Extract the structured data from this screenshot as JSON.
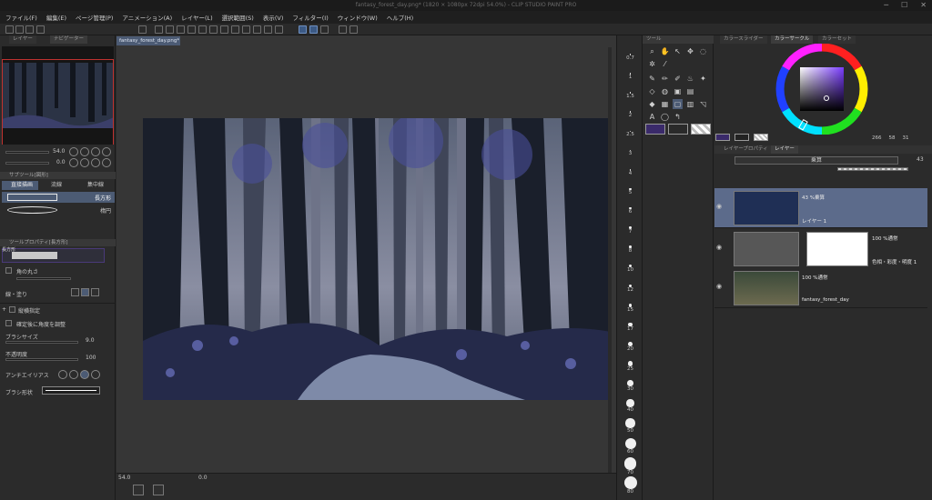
{
  "titlebar": {
    "text": "fantasy_forest_day.png* (1820 × 1080px 72dpi 54.0%) - CLIP STUDIO PAINT PRO"
  },
  "menu": [
    "ファイル(F)",
    "編集(E)",
    "ページ管理(P)",
    "アニメーション(A)",
    "レイヤー(L)",
    "選択範囲(S)",
    "表示(V)",
    "フィルター(I)",
    "ウィンドウ(W)",
    "ヘルプ(H)"
  ],
  "left": {
    "tab_layer_property": "レイヤー",
    "tab_navigator": "ナビゲーター",
    "zoom_value": "54.0",
    "rotate_value": "0.0",
    "subtool_header": "サブツール[図形]",
    "subtool_tabs": [
      "直接描画",
      "流線",
      "集中線"
    ],
    "shape_rect": "長方形",
    "shape_ellipse": "楕円",
    "tool_prop_header": "ツールプロパティ[長方形]",
    "corner_label": "角の丸さ",
    "line_fill_label": "線・塗り",
    "aspect_label": "縦横指定",
    "angle_label": "確定後に角度を調整",
    "brush_size_label": "ブラシサイズ",
    "brush_size_value": "9.0",
    "opacity_label": "不透明度",
    "opacity_value": "100",
    "antialias_label": "アンチエイリアス",
    "brush_shape_label": "ブラシ形状",
    "long_label": "長方形"
  },
  "canvas": {
    "doc_tab": "fantasy_forest_day.png*",
    "zoom_status": "54.0",
    "angle_status": "0.0"
  },
  "sizes": [
    "0.7",
    "1",
    "1.5",
    "2",
    "2.5",
    "3",
    "4",
    "5",
    "6",
    "7",
    "8",
    "10",
    "12",
    "15",
    "17",
    "20",
    "25",
    "30",
    "40",
    "50",
    "60",
    "70",
    "80"
  ],
  "right": {
    "tab_tool": "ツール",
    "tab_color_slider": "カラースライダー",
    "tab_color_circle": "カラーサークル",
    "tab_color_set": "カラーセット",
    "hsv_h": "266",
    "hsv_s": "58",
    "hsv_v": "31",
    "layer_tab_property": "レイヤープロパティ",
    "layer_tab_layer": "レイヤー",
    "blend_mode": "乗算",
    "opacity_value": "43",
    "layers": [
      {
        "line1": "43 %乗算",
        "line2": "レイヤー 1"
      },
      {
        "line1": "100 %通常",
        "line2": "色相・彩度・明度 1"
      },
      {
        "line1": "100 %通常",
        "line2": "fantasy_forest_day"
      }
    ]
  },
  "colors": {
    "accent": "#4c5b74",
    "main_color": "#3a2a6a",
    "sub_color": "#2a2a2a"
  }
}
